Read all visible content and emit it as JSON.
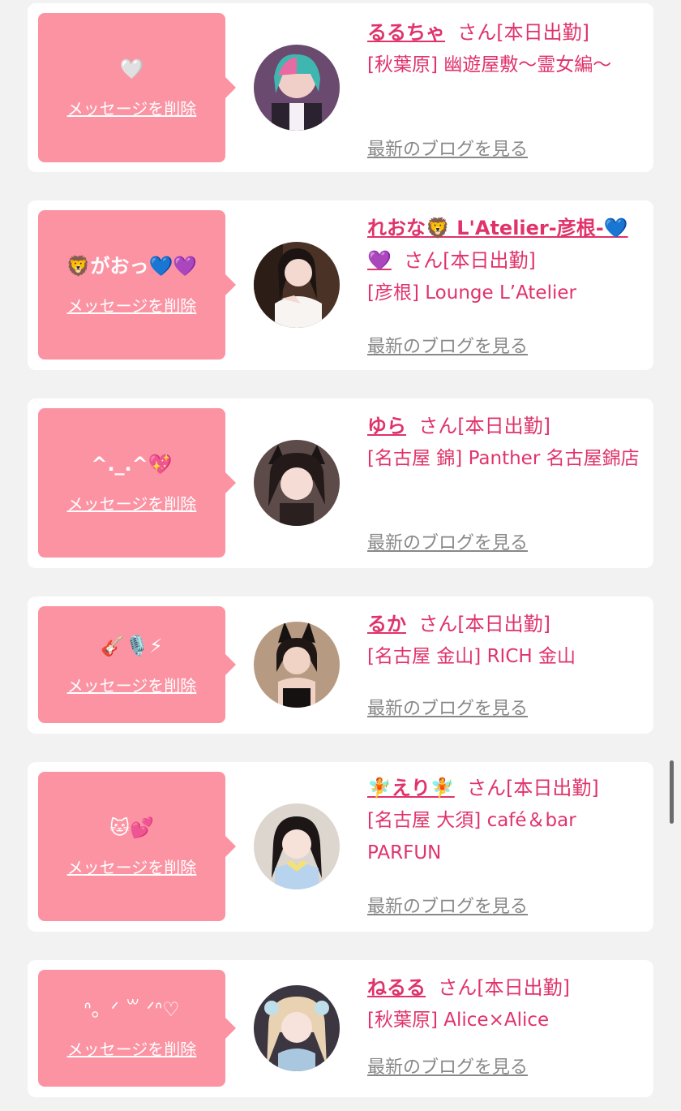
{
  "delete_label": "メッセージを削除",
  "blog_label": "最新のブログを見る",
  "colors": {
    "accent": "#e0336b",
    "bubble": "#fc93a3",
    "link_gray": "#888888",
    "background": "#f2f2f2"
  },
  "cards": [
    {
      "message": "🤍",
      "name": "るるちゃ",
      "status": "さん[本日出勤]",
      "shop": "[秋葉原] 幽遊屋敷〜霊女編〜",
      "avatar_icon": "cast-photo-avatar"
    },
    {
      "message": "🦁がおっ💙💜",
      "name": "れおな🦁 L'Atelier-彦根-💙💜",
      "status": "さん[本日出勤]",
      "shop": "[彦根] Lounge L’Atelier",
      "avatar_icon": "cast-photo-avatar"
    },
    {
      "message": "^._.^💖",
      "name": "ゆら",
      "status": "さん[本日出勤]",
      "shop": "[名古屋 錦] Panther 名古屋錦店",
      "avatar_icon": "cast-photo-avatar"
    },
    {
      "message": "🎸🎙️⚡",
      "name": "るか",
      "status": "さん[本日出勤]",
      "shop": "[名古屋 金山] RICH 金山",
      "avatar_icon": "cast-photo-avatar"
    },
    {
      "message": "🐱💕",
      "name": "🧚えり🧚",
      "status": "さん[本日出勤]",
      "shop": "[名古屋 大須] café＆bar PARFUN",
      "avatar_icon": "cast-photo-avatar"
    },
    {
      "message": "ᐢ。ᐟ ꒳ ᐟᐢ♡",
      "name": "ねるる",
      "status": "さん[本日出勤]",
      "shop": "[秋葉原] Alice×Alice",
      "avatar_icon": "cast-photo-avatar"
    }
  ]
}
